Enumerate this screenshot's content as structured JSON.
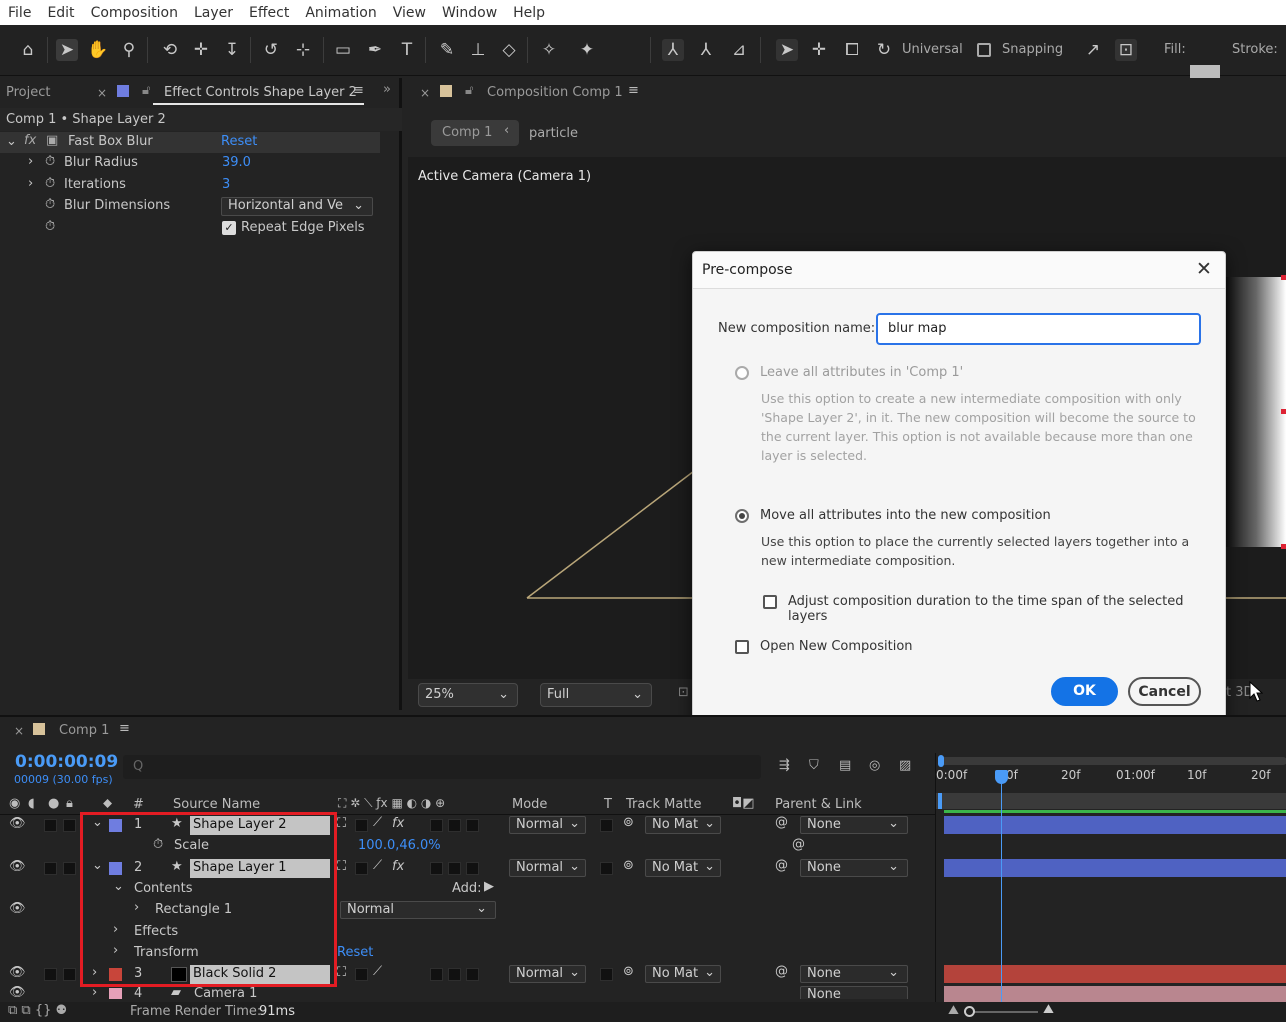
{
  "menubar": [
    "File",
    "Edit",
    "Composition",
    "Layer",
    "Effect",
    "Animation",
    "View",
    "Window",
    "Help"
  ],
  "toolbar": {
    "universal": "Universal",
    "snapping": "Snapping",
    "fill": "Fill:",
    "stroke": "Stroke:"
  },
  "left_panel": {
    "tab_project": "Project",
    "tab_effect_controls": "Effect Controls Shape Layer 2",
    "subtitle": "Comp 1 • Shape Layer 2",
    "effect_name": "Fast Box Blur",
    "reset": "Reset",
    "props": [
      {
        "name": "Blur Radius",
        "value": "39.0"
      },
      {
        "name": "Iterations",
        "value": "3"
      },
      {
        "name": "Blur Dimensions",
        "value": "Horizontal and Ve"
      },
      {
        "name": "",
        "value": "Repeat Edge Pixels"
      }
    ]
  },
  "comp_panel": {
    "tab": "Composition Comp 1",
    "crumb1": "Comp 1",
    "crumb2": "particle",
    "camera": "Active Camera (Camera 1)",
    "zoom": "25%",
    "res": "Full",
    "extra": "t 3D"
  },
  "dialog": {
    "title": "Pre-compose",
    "name_label": "New composition name:",
    "name_value": "blur map",
    "opt1_label": "Leave all attributes in 'Comp 1'",
    "opt1_desc": "Use this option to create a new intermediate composition with only 'Shape Layer 2', in it. The new composition will become the source to the current layer. This option is not available because more than one layer is selected.",
    "opt2_label": "Move all attributes into the new composition",
    "opt2_desc": "Use this option to place the currently selected layers together into a new intermediate composition.",
    "adjust_label": "Adjust composition duration to the time span of the selected layers",
    "open_label": "Open New Composition",
    "ok": "OK",
    "cancel": "Cancel"
  },
  "timeline": {
    "tab": "Comp 1",
    "timecode": "0:00:00:09",
    "frames": "00009 (30.00 fps)",
    "search_placeholder": "Q",
    "headers": {
      "num": "#",
      "source": "Source Name",
      "mode": "Mode",
      "t": "T",
      "matte": "Track Matte",
      "parent": "Parent & Link"
    },
    "ruler": [
      "0:00f",
      "0f",
      "20f",
      "01:00f",
      "10f",
      "20f"
    ],
    "layers": [
      {
        "num": "1",
        "name": "Shape Layer 2",
        "mode": "Normal",
        "matte": "No Mat",
        "parent": "None",
        "color": "#6f7de0"
      },
      {
        "num": "2",
        "name": "Shape Layer 1",
        "mode": "Normal",
        "matte": "No Mat",
        "parent": "None",
        "color": "#6f7de0"
      },
      {
        "num": "3",
        "name": "Black Solid 2",
        "mode": "Normal",
        "matte": "No Mat",
        "parent": "None",
        "color": "#c8453a"
      },
      {
        "num": "4",
        "name": "Camera 1",
        "parent": "None",
        "color": "#e6a0b8"
      }
    ],
    "scale_label": "Scale",
    "scale_value": "100.0,46.0%",
    "contents": "Contents",
    "add": "Add:",
    "rectangle": "Rectangle 1",
    "rect_mode": "Normal",
    "effects": "Effects",
    "transform": "Transform",
    "transform_reset": "Reset",
    "frame_render": "Frame Render Time:",
    "frame_render_value": "91ms"
  }
}
